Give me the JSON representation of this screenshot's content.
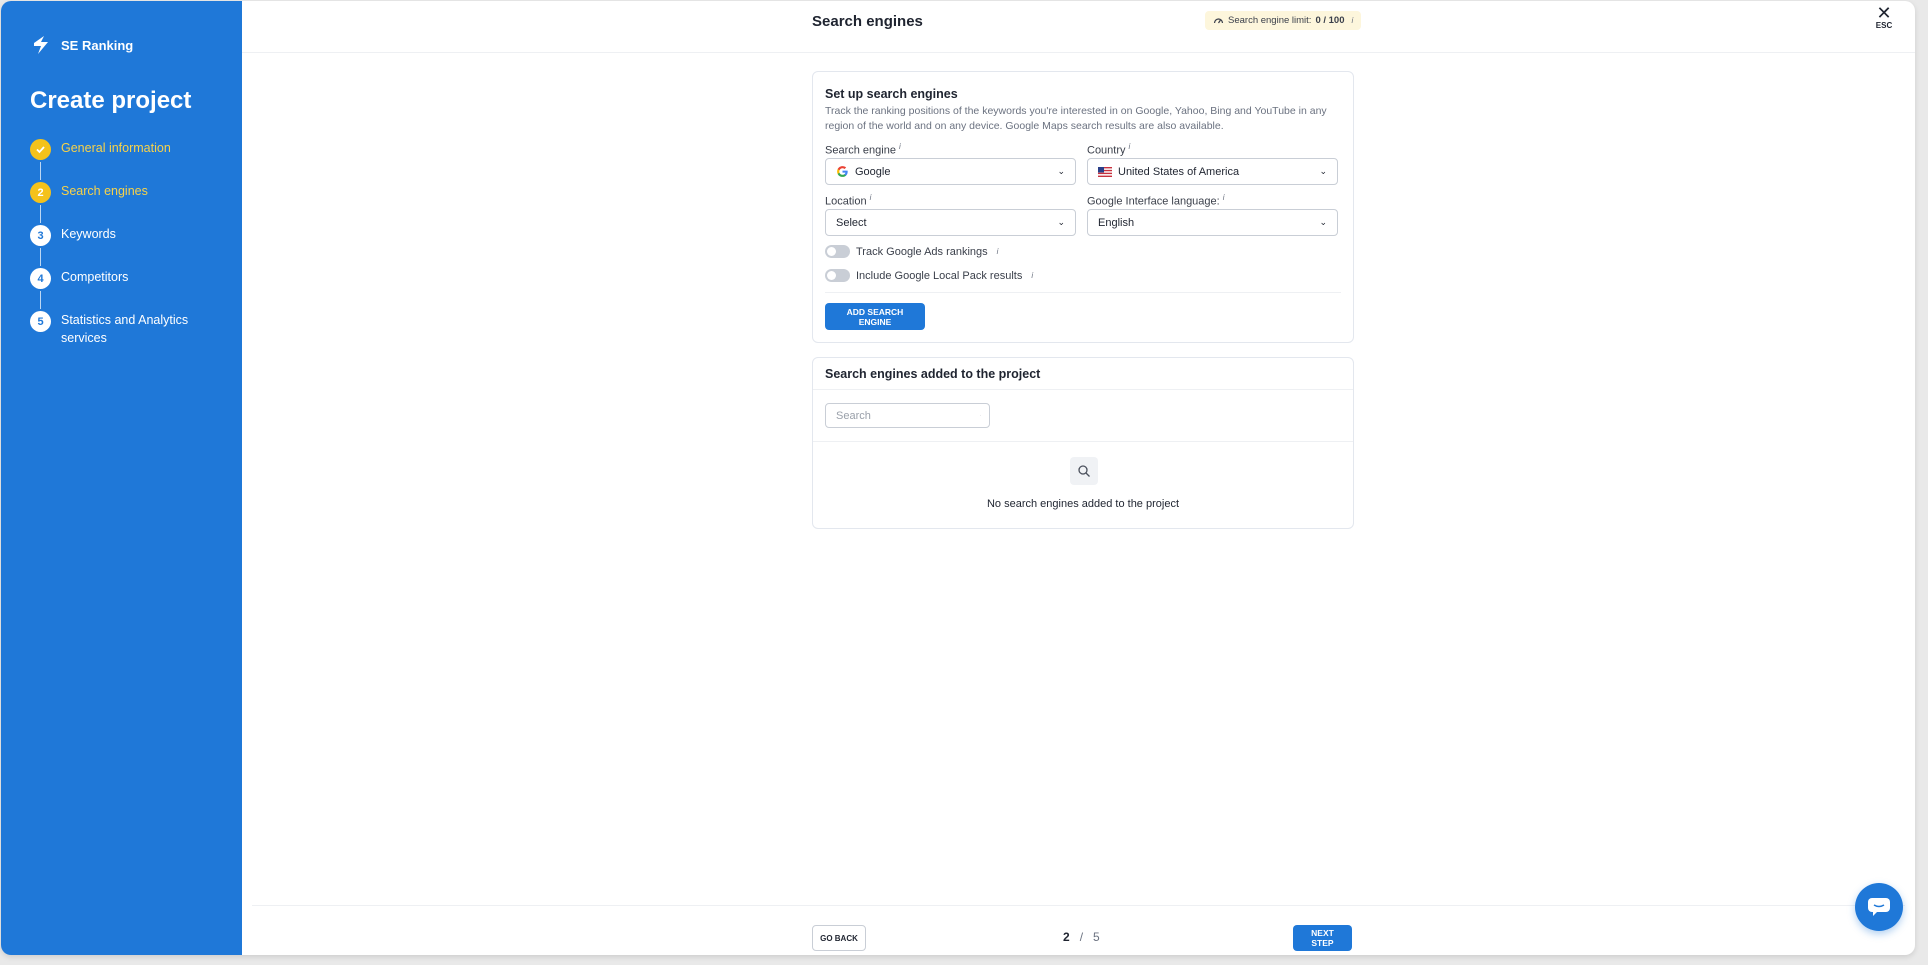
{
  "brand": {
    "name": "SE Ranking"
  },
  "sidebar": {
    "title": "Create project",
    "steps": [
      {
        "num": "1",
        "label": "General information",
        "state": "done"
      },
      {
        "num": "2",
        "label": "Search engines",
        "state": "active"
      },
      {
        "num": "3",
        "label": "Keywords",
        "state": "pending"
      },
      {
        "num": "4",
        "label": "Competitors",
        "state": "pending"
      },
      {
        "num": "5",
        "label": "Statistics and Analytics services",
        "state": "pending"
      }
    ]
  },
  "header": {
    "title": "Search engines",
    "limit_label": "Search engine limit:",
    "limit_value": "0 / 100",
    "esc": "ESC"
  },
  "setup": {
    "title": "Set up search engines",
    "description": "Track the ranking positions of the keywords you're interested in on Google, Yahoo, Bing and YouTube in any region of the world and on any device. Google Maps search results are also available.",
    "engine_label": "Search engine",
    "engine_value": "Google",
    "country_label": "Country",
    "country_value": "United States of America",
    "location_label": "Location",
    "location_value": "Select",
    "language_label": "Google Interface language:",
    "language_value": "English",
    "toggle_ads": "Track Google Ads rankings",
    "toggle_local": "Include Google Local Pack results",
    "add_button": "ADD SEARCH ENGINE"
  },
  "added": {
    "title": "Search engines added to the project",
    "search_placeholder": "Search",
    "empty_text": "No search engines added to the project"
  },
  "footer": {
    "back": "GO BACK",
    "page_current": "2",
    "page_sep": "/",
    "page_total": "5",
    "next": "NEXT STEP"
  },
  "colors": {
    "sidebar_bg": "#1f78d8",
    "accent_yellow": "#f4c21b",
    "primary_button": "#1f78d8"
  }
}
